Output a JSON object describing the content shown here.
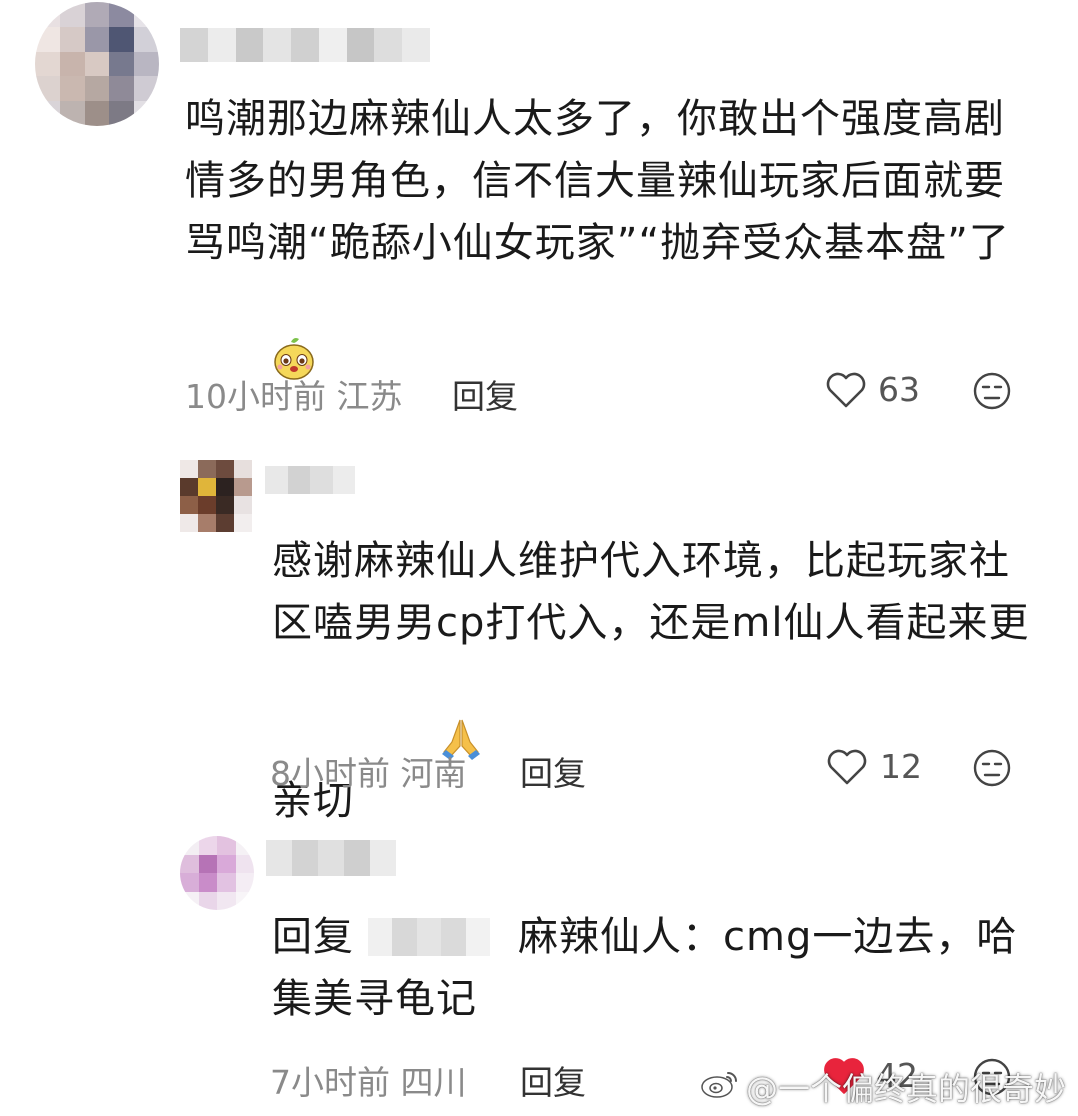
{
  "comments": [
    {
      "text": "鸣潮那边麻辣仙人太多了，你敢出个强度高剧情多的男角色，信不信大量辣仙玩家后面就要骂鸣潮“跪舔小仙女玩家”“抛弃受众基本盘”了",
      "time": "10小时前",
      "location": "江苏",
      "reply_label": "回复",
      "likes": "63",
      "liked": false
    },
    {
      "text": "感谢麻辣仙人维护代入环境，比起玩家社区嗑男男cp打代入，还是ml仙人看起来更亲切",
      "time": "8小时前",
      "location": "河南",
      "reply_label": "回复",
      "likes": "12",
      "liked": false
    },
    {
      "reply_prefix": "回复",
      "text": "麻辣仙人：cmg一边去，哈集美寻龟记",
      "time": "7小时前",
      "location": "四川",
      "reply_label": "回复",
      "likes": "42",
      "liked": true
    }
  ],
  "watermark": "@一个偏终真的很奇妙",
  "colors": {
    "like_red": "#e8243c",
    "meta_gray": "#8a8a8a"
  },
  "icons": [
    "heart-icon",
    "dislike-face-icon",
    "emoji-sticker-icon",
    "praying-hands-icon",
    "weibo-logo-icon"
  ]
}
